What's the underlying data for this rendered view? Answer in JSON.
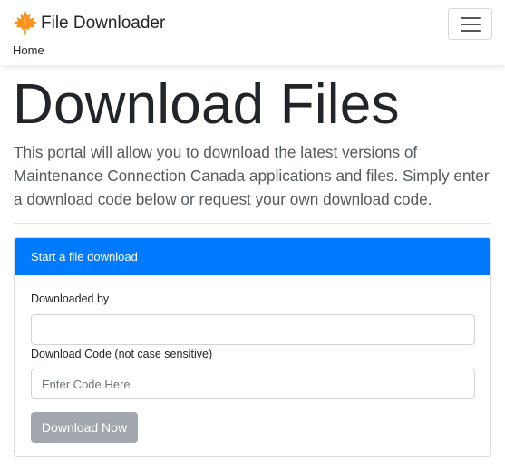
{
  "navbar": {
    "brand_text": "File Downloader",
    "brand_icon": "maple-leaf-icon",
    "menu_icon": "hamburger-menu-icon",
    "brand_color": "#f7931e"
  },
  "breadcrumb": {
    "home_label": "Home"
  },
  "main": {
    "title": "Download Files",
    "lead": "This portal will allow you to download the latest versions of Maintenance Connection Canada applications and files. Simply enter a download code below or request your own download code."
  },
  "form": {
    "header": "Start a file download",
    "downloaded_by_label": "Downloaded by",
    "downloaded_by_value": "",
    "code_label": "Download Code (not case sensitive)",
    "code_placeholder": "Enter Code Here",
    "code_value": "",
    "submit_label": "Download Now",
    "header_color": "#007bff",
    "button_color": "#a2a7ad"
  }
}
